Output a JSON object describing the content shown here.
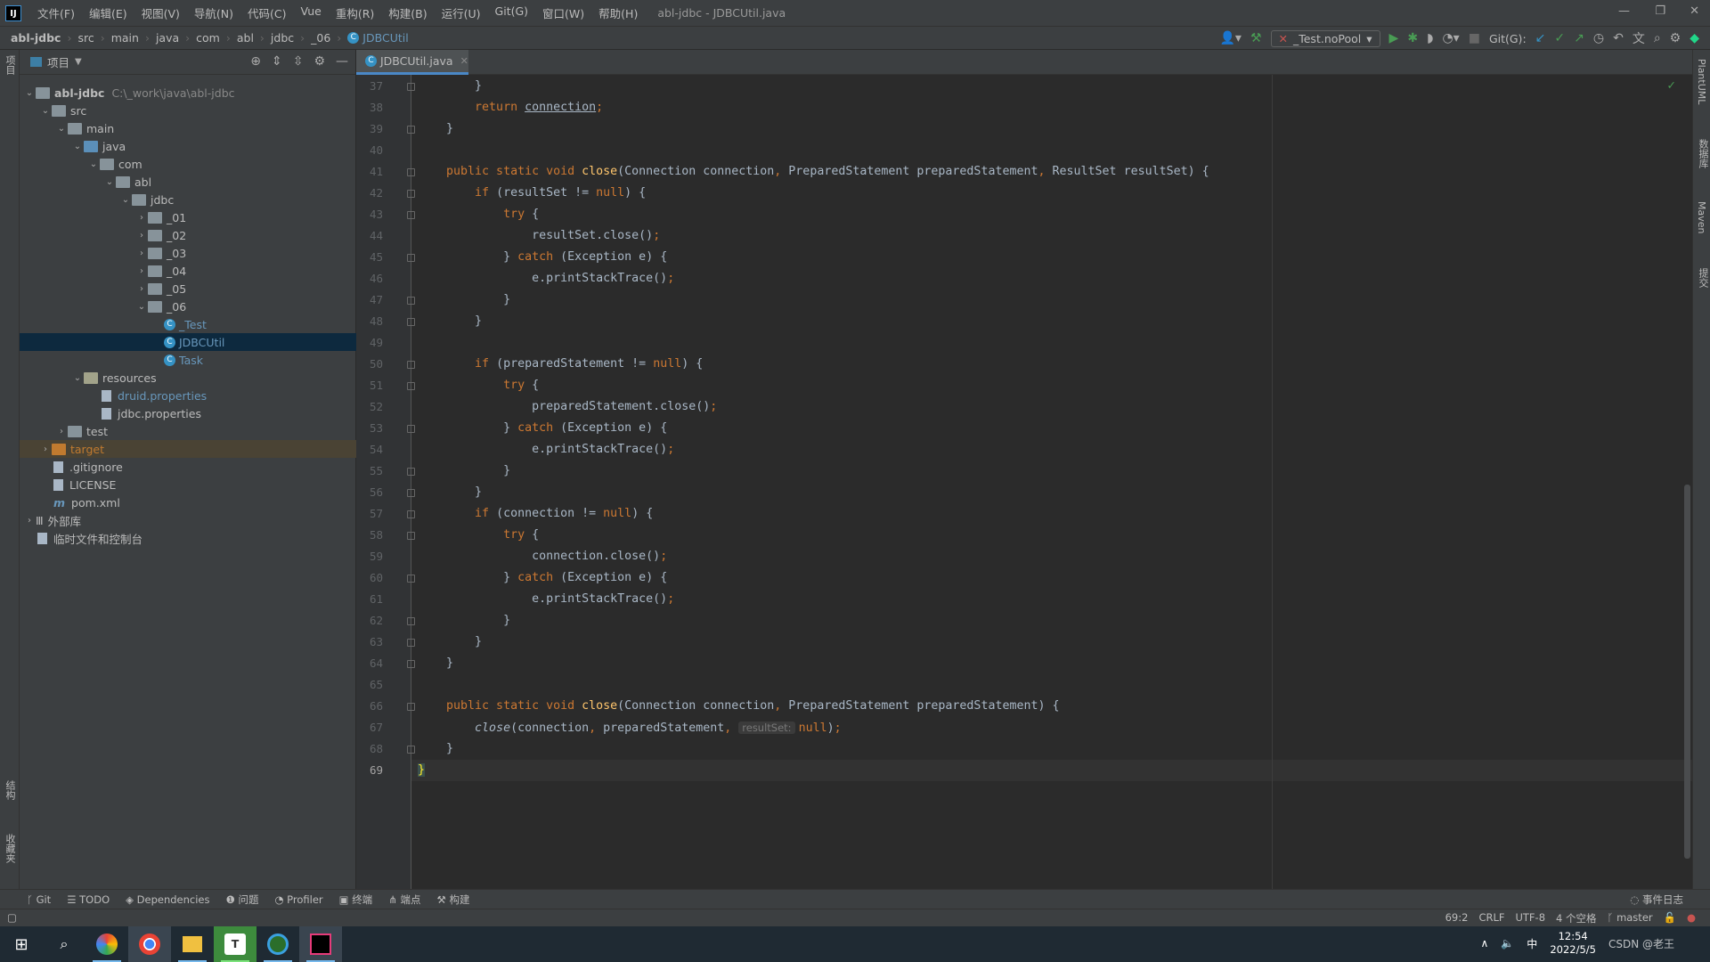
{
  "window": {
    "title": "abl-jdbc - JDBCUtil.java",
    "logo": "IJ"
  },
  "menu": [
    "文件(F)",
    "编辑(E)",
    "视图(V)",
    "导航(N)",
    "代码(C)",
    "Vue",
    "重构(R)",
    "构建(B)",
    "运行(U)",
    "Git(G)",
    "窗口(W)",
    "帮助(H)"
  ],
  "breadcrumb": [
    "abl-jdbc",
    "src",
    "main",
    "java",
    "com",
    "abl",
    "jdbc",
    "_06",
    "JDBCUtil"
  ],
  "toolbar": {
    "run_config": "_Test.noPool",
    "git_label": "Git(G):"
  },
  "left_stripe": {
    "project": "项目",
    "structure": "结构",
    "favorites": "收藏夹"
  },
  "right_stripe": {
    "plantuml": "PlantUML",
    "database": "数据库",
    "maven": "Maven",
    "commit": "提交"
  },
  "project": {
    "title": "项目",
    "tree": [
      {
        "label": "abl-jdbc",
        "path": "C:\\_work\\java\\abl-jdbc",
        "depth": 0,
        "arrow": "open",
        "icon": "module",
        "bold": true
      },
      {
        "label": "src",
        "depth": 1,
        "arrow": "open",
        "icon": "folder"
      },
      {
        "label": "main",
        "depth": 2,
        "arrow": "open",
        "icon": "folder"
      },
      {
        "label": "java",
        "depth": 3,
        "arrow": "open",
        "icon": "src-folder"
      },
      {
        "label": "com",
        "depth": 4,
        "arrow": "open",
        "icon": "folder"
      },
      {
        "label": "abl",
        "depth": 5,
        "arrow": "open",
        "icon": "folder"
      },
      {
        "label": "jdbc",
        "depth": 6,
        "arrow": "open",
        "icon": "folder"
      },
      {
        "label": "_01",
        "depth": 7,
        "arrow": "closed",
        "icon": "folder"
      },
      {
        "label": "_02",
        "depth": 7,
        "arrow": "closed",
        "icon": "folder"
      },
      {
        "label": "_03",
        "depth": 7,
        "arrow": "closed",
        "icon": "folder"
      },
      {
        "label": "_04",
        "depth": 7,
        "arrow": "closed",
        "icon": "folder"
      },
      {
        "label": "_05",
        "depth": 7,
        "arrow": "closed",
        "icon": "folder"
      },
      {
        "label": "_06",
        "depth": 7,
        "arrow": "open",
        "icon": "folder"
      },
      {
        "label": "_Test",
        "depth": 8,
        "icon": "class",
        "color": "#6897bb"
      },
      {
        "label": "JDBCUtil",
        "depth": 8,
        "icon": "class",
        "color": "#6897bb",
        "selected": true
      },
      {
        "label": "Task",
        "depth": 8,
        "icon": "class",
        "color": "#6897bb"
      },
      {
        "label": "resources",
        "depth": 3,
        "arrow": "open",
        "icon": "res-folder"
      },
      {
        "label": "druid.properties",
        "depth": 4,
        "icon": "properties",
        "color": "#6897bb"
      },
      {
        "label": "jdbc.properties",
        "depth": 4,
        "icon": "properties"
      },
      {
        "label": "test",
        "depth": 2,
        "arrow": "closed",
        "icon": "folder"
      },
      {
        "label": "target",
        "depth": 1,
        "arrow": "closed",
        "icon": "excluded-folder",
        "color": "#c07a2f",
        "highlight": true
      },
      {
        "label": ".gitignore",
        "depth": 1,
        "icon": "file"
      },
      {
        "label": "LICENSE",
        "depth": 1,
        "icon": "file"
      },
      {
        "label": "pom.xml",
        "depth": 1,
        "icon": "maven"
      },
      {
        "label": "外部库",
        "depth": 0,
        "arrow": "closed",
        "icon": "library"
      },
      {
        "label": "临时文件和控制台",
        "depth": 0,
        "icon": "scratch"
      }
    ]
  },
  "editor": {
    "tab": "JDBCUtil.java",
    "current_line": 69,
    "lines": [
      {
        "n": 37,
        "t": [
          [
            "st",
            "        }"
          ]
        ]
      },
      {
        "n": 38,
        "t": [
          [
            "kw",
            "        return "
          ],
          [
            "ul",
            "connection"
          ],
          [
            "kw",
            ";"
          ]
        ]
      },
      {
        "n": 39,
        "t": [
          [
            "st",
            "    }"
          ]
        ]
      },
      {
        "n": 40,
        "t": []
      },
      {
        "n": 41,
        "t": [
          [
            "kw",
            "    public static void "
          ],
          [
            "fn",
            "close"
          ],
          [
            "st",
            "(Connection connection"
          ],
          [
            "kw",
            ", "
          ],
          [
            "st",
            "PreparedStatement preparedStatement"
          ],
          [
            "kw",
            ", "
          ],
          [
            "st",
            "ResultSet resultSet) {"
          ]
        ]
      },
      {
        "n": 42,
        "t": [
          [
            "kw",
            "        if "
          ],
          [
            "st",
            "(resultSet != "
          ],
          [
            "kw",
            "null"
          ],
          [
            "st",
            ") {"
          ]
        ]
      },
      {
        "n": 43,
        "t": [
          [
            "kw",
            "            try "
          ],
          [
            "st",
            "{"
          ]
        ]
      },
      {
        "n": 44,
        "t": [
          [
            "st",
            "                resultSet.close()"
          ],
          [
            "kw",
            ";"
          ]
        ]
      },
      {
        "n": 45,
        "t": [
          [
            "st",
            "            } "
          ],
          [
            "kw",
            "catch "
          ],
          [
            "st",
            "(Exception e) {"
          ]
        ]
      },
      {
        "n": 46,
        "t": [
          [
            "st",
            "                e.printStackTrace()"
          ],
          [
            "kw",
            ";"
          ]
        ]
      },
      {
        "n": 47,
        "t": [
          [
            "st",
            "            }"
          ]
        ]
      },
      {
        "n": 48,
        "t": [
          [
            "st",
            "        }"
          ]
        ]
      },
      {
        "n": 49,
        "t": []
      },
      {
        "n": 50,
        "t": [
          [
            "kw",
            "        if "
          ],
          [
            "st",
            "(preparedStatement != "
          ],
          [
            "kw",
            "null"
          ],
          [
            "st",
            ") {"
          ]
        ]
      },
      {
        "n": 51,
        "t": [
          [
            "kw",
            "            try "
          ],
          [
            "st",
            "{"
          ]
        ]
      },
      {
        "n": 52,
        "t": [
          [
            "st",
            "                preparedStatement.close()"
          ],
          [
            "kw",
            ";"
          ]
        ]
      },
      {
        "n": 53,
        "t": [
          [
            "st",
            "            } "
          ],
          [
            "kw",
            "catch "
          ],
          [
            "st",
            "(Exception e) {"
          ]
        ]
      },
      {
        "n": 54,
        "t": [
          [
            "st",
            "                e.printStackTrace()"
          ],
          [
            "kw",
            ";"
          ]
        ]
      },
      {
        "n": 55,
        "t": [
          [
            "st",
            "            }"
          ]
        ]
      },
      {
        "n": 56,
        "t": [
          [
            "st",
            "        }"
          ]
        ]
      },
      {
        "n": 57,
        "t": [
          [
            "kw",
            "        if "
          ],
          [
            "st",
            "(connection != "
          ],
          [
            "kw",
            "null"
          ],
          [
            "st",
            ") {"
          ]
        ]
      },
      {
        "n": 58,
        "t": [
          [
            "kw",
            "            try "
          ],
          [
            "st",
            "{"
          ]
        ]
      },
      {
        "n": 59,
        "t": [
          [
            "st",
            "                connection.close()"
          ],
          [
            "kw",
            ";"
          ]
        ]
      },
      {
        "n": 60,
        "t": [
          [
            "st",
            "            } "
          ],
          [
            "kw",
            "catch "
          ],
          [
            "st",
            "(Exception e) {"
          ]
        ]
      },
      {
        "n": 61,
        "t": [
          [
            "st",
            "                e.printStackTrace()"
          ],
          [
            "kw",
            ";"
          ]
        ]
      },
      {
        "n": 62,
        "t": [
          [
            "st",
            "            }"
          ]
        ]
      },
      {
        "n": 63,
        "t": [
          [
            "st",
            "        }"
          ]
        ]
      },
      {
        "n": 64,
        "t": [
          [
            "st",
            "    }"
          ]
        ]
      },
      {
        "n": 65,
        "t": []
      },
      {
        "n": 66,
        "t": [
          [
            "kw",
            "    public static void "
          ],
          [
            "fn",
            "close"
          ],
          [
            "st",
            "(Connection connection"
          ],
          [
            "kw",
            ", "
          ],
          [
            "st",
            "PreparedStatement preparedStatement) {"
          ]
        ]
      },
      {
        "n": 67,
        "t": [
          [
            "st",
            "        "
          ],
          [
            "it",
            "close"
          ],
          [
            "st",
            "(connection"
          ],
          [
            "kw",
            ", "
          ],
          [
            "st",
            "preparedStatement"
          ],
          [
            "kw",
            ", "
          ],
          [
            "hint",
            "resultSet:"
          ],
          [
            "kw",
            "null"
          ],
          [
            "st",
            ")"
          ],
          [
            "kw",
            ";"
          ]
        ]
      },
      {
        "n": 68,
        "t": [
          [
            "st",
            "    }"
          ]
        ]
      },
      {
        "n": 69,
        "t": [
          [
            "brace",
            "}"
          ]
        ]
      }
    ]
  },
  "tool_windows": [
    "Git",
    "TODO",
    "Dependencies",
    "问题",
    "Profiler",
    "终端",
    "端点",
    "构建"
  ],
  "event_log": "事件日志",
  "status": {
    "position": "69:2",
    "line_sep": "CRLF",
    "encoding": "UTF-8",
    "indent": "4 个空格",
    "branch": "master"
  },
  "taskbar": {
    "time": "12:54",
    "date": "2022/5/5",
    "ime": "中",
    "watermark": "CSDN @老王"
  }
}
